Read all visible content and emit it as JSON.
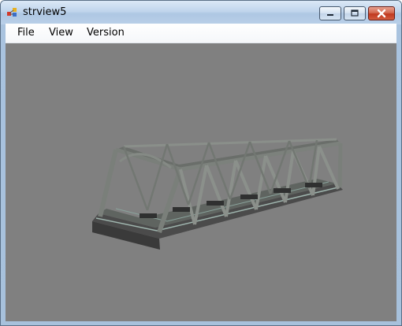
{
  "window": {
    "title": "strview5"
  },
  "menu": {
    "file": "File",
    "view": "View",
    "version": "Version"
  },
  "viewport": {
    "background_color": "#808080",
    "model": "truss-bridge"
  },
  "icons": {
    "app": "app-icon",
    "minimize": "minimize-icon",
    "maximize": "maximize-icon",
    "close": "close-icon"
  },
  "colors": {
    "titlebar": "#bcd3ea",
    "close_button": "#c0391f",
    "viewport": "#808080"
  }
}
